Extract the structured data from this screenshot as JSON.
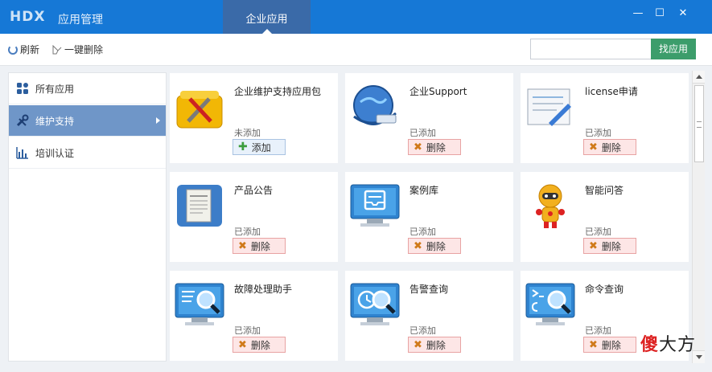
{
  "titlebar": {
    "logo": "HDX",
    "app_title": "应用管理",
    "active_tab": "企业应用",
    "minimize": "—",
    "maximize": "☐",
    "close": "✕"
  },
  "toolbar": {
    "refresh_label": "刷新",
    "delete_all_label": "一键删除",
    "search_placeholder": "",
    "search_value": "",
    "search_button": "找应用"
  },
  "sidebar": {
    "items": [
      {
        "label": "所有应用",
        "icon": "apps-grid-icon",
        "active": false
      },
      {
        "label": "维护支持",
        "icon": "tools-icon",
        "active": true
      },
      {
        "label": "培训认证",
        "icon": "bar-chart-icon",
        "active": false
      }
    ]
  },
  "cards": [
    {
      "title": "企业维护支持应用包",
      "status": "未添加",
      "button": "添加",
      "action": "add",
      "icon": "toolbox-icon"
    },
    {
      "title": "企业Support",
      "status": "已添加",
      "button": "删除",
      "action": "delete",
      "icon": "globe-network-icon"
    },
    {
      "title": "license申请",
      "status": "已添加",
      "button": "删除",
      "action": "delete",
      "icon": "document-pen-icon"
    },
    {
      "title": "产品公告",
      "status": "已添加",
      "button": "删除",
      "action": "delete",
      "icon": "announcement-doc-icon"
    },
    {
      "title": "案例库",
      "status": "已添加",
      "button": "删除",
      "action": "delete",
      "icon": "monitor-inbox-icon"
    },
    {
      "title": "智能问答",
      "status": "已添加",
      "button": "删除",
      "action": "delete",
      "icon": "robot-icon"
    },
    {
      "title": "故障处理助手",
      "status": "已添加",
      "button": "删除",
      "action": "delete",
      "icon": "monitor-search-icon"
    },
    {
      "title": "告警查询",
      "status": "已添加",
      "button": "删除",
      "action": "delete",
      "icon": "monitor-alarm-search-icon"
    },
    {
      "title": "命令查询",
      "status": "已添加",
      "button": "删除",
      "action": "delete",
      "icon": "monitor-command-search-icon"
    }
  ],
  "watermark": {
    "text1": "傻",
    "text2": "大方"
  },
  "colors": {
    "brand": "#1678d6",
    "active_tab": "#3a6aa8",
    "sidebar_active": "#6f96c8",
    "search_button": "#3c9d6b"
  }
}
